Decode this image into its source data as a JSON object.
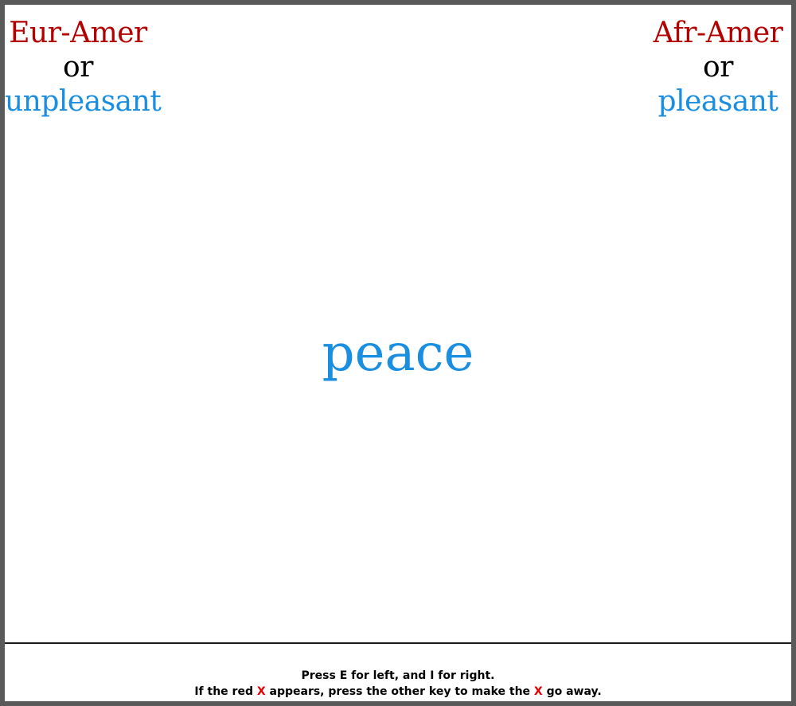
{
  "left_category": {
    "primary": "Eur-Amer",
    "connector": "or",
    "secondary": "unpleasant"
  },
  "right_category": {
    "primary": "Afr-Amer",
    "connector": "or",
    "secondary": "pleasant"
  },
  "stimulus": {
    "word": "peace"
  },
  "instructions": {
    "line1": "Press E for left, and I for right.",
    "line2_before": "If the red ",
    "x_marker": "X",
    "line2_middle": " appears, press the other key to make the ",
    "line2_after": " go away."
  },
  "colors": {
    "category_primary": "#b30000",
    "category_secondary": "#1a8ee0",
    "stimulus": "#1a8ee0",
    "error_marker": "#e00000",
    "frame_border": "#5a5a5a"
  }
}
